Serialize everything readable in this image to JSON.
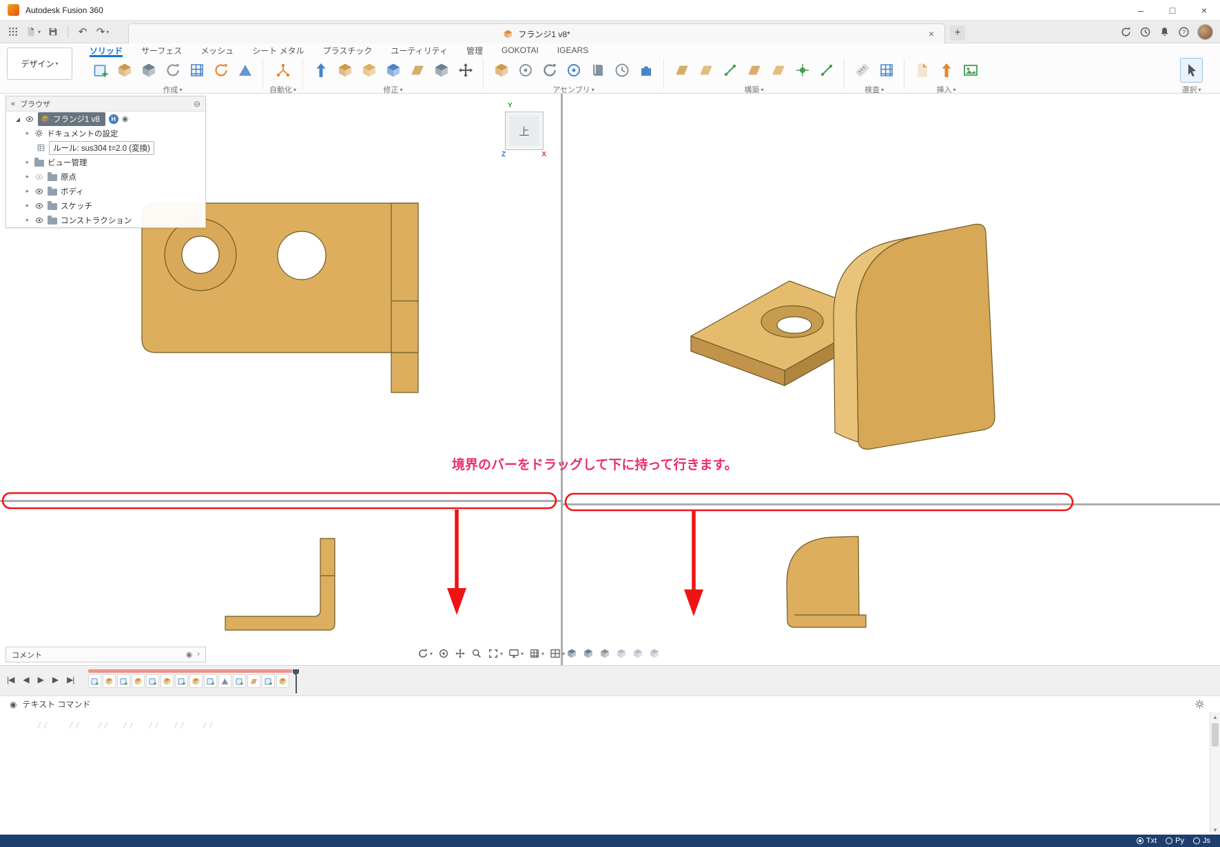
{
  "titlebar": {
    "app_title": "Autodesk Fusion 360",
    "window_controls": {
      "minimize": "–",
      "maximize": "□",
      "close": "×"
    }
  },
  "tabbar": {
    "document_tab": {
      "label": "フランジ1 v8*",
      "close": "×"
    },
    "new_tab": "+",
    "left_icons": [
      "app-grid",
      "file-new",
      "save",
      "undo",
      "redo"
    ],
    "right_icons": [
      "job-status",
      "version-history",
      "notifications",
      "help",
      "avatar"
    ]
  },
  "ribbon": {
    "workspace_button": "デザイン",
    "tabs": [
      {
        "label": "ソリッド",
        "active": true
      },
      {
        "label": "サーフェス",
        "active": false
      },
      {
        "label": "メッシュ",
        "active": false
      },
      {
        "label": "シート メタル",
        "active": false
      },
      {
        "label": "プラスチック",
        "active": false
      },
      {
        "label": "ユーティリティ",
        "active": false
      },
      {
        "label": "管理",
        "active": false
      },
      {
        "label": "GOKOTAI",
        "active": false
      },
      {
        "label": "IGEARS",
        "active": false
      }
    ],
    "groups": [
      {
        "label": "作成",
        "icons": [
          "create-sketch",
          "create-form",
          "extrude",
          "revolve",
          "pattern",
          "coil",
          "loft"
        ]
      },
      {
        "label": "自動化",
        "icons": [
          "automated-modeling"
        ]
      },
      {
        "label": "修正",
        "icons": [
          "press-pull",
          "fillet",
          "shell",
          "combine",
          "replace-face",
          "split-body",
          "move-copy"
        ]
      },
      {
        "label": "アセンブリ",
        "icons": [
          "new-component",
          "joint",
          "as-built-joint",
          "joint-origin",
          "rigid-group",
          "motion-study",
          "contact-sets"
        ]
      },
      {
        "label": "構築",
        "icons": [
          "offset-plane",
          "midplane",
          "axis",
          "plane-at-angle",
          "tangent-plane",
          "point",
          "line"
        ]
      },
      {
        "label": "検査",
        "icons": [
          "measure",
          "section-analysis"
        ]
      },
      {
        "label": "挿入",
        "icons": [
          "insert-derive",
          "insert-dxf",
          "canvas"
        ]
      },
      {
        "label": "選択",
        "icons": [
          "select"
        ]
      }
    ]
  },
  "browser": {
    "title": "ブラウザ",
    "root": {
      "label": "フランジ1 v8",
      "badge": "H"
    },
    "items": [
      {
        "label": "ドキュメントの設定",
        "icon": "gear"
      },
      {
        "label": "ルール: sus304 t=2.0 (変換)",
        "icon": "rule-sheet"
      },
      {
        "label": "ビュー管理",
        "icon": "folder"
      },
      {
        "label": "原点",
        "icon": "folder",
        "visible": false
      },
      {
        "label": "ボディ",
        "icon": "folder",
        "visible": true
      },
      {
        "label": "スケッチ",
        "icon": "folder",
        "visible": true
      },
      {
        "label": "コンストラクション",
        "icon": "folder",
        "visible": true
      }
    ]
  },
  "viewcube": {
    "face": "上",
    "axis_x": "X",
    "axis_y": "Y",
    "axis_z": "Z"
  },
  "annotation": {
    "text": "境界のバーをドラッグして下に持って行きます。",
    "color": "#ea2e66",
    "highlight_color": "#f01616"
  },
  "panels": {
    "comment": "コメント",
    "text_command": "テキスト コマンド",
    "text_command_ghost": "/ /       / /      / /     / /     / /     / /      / /"
  },
  "nav_toolbar": {
    "left": [
      "orbit",
      "look-at",
      "pan",
      "zoom",
      "fit",
      "display-settings",
      "grid-settings",
      "viewport-layout"
    ],
    "right": [
      "shaded-cube",
      "shaded-cube",
      "shaded-cube",
      "wire-cube",
      "wire-cube",
      "wire-cube"
    ]
  },
  "timeline": {
    "playback": [
      "go-to-start",
      "step-back",
      "play",
      "step-forward",
      "go-to-end"
    ],
    "playback_glyphs": [
      "|◀",
      "◀",
      "▶",
      "▶",
      "▶|"
    ],
    "features": [
      "sketch",
      "extrude",
      "sketch",
      "hole",
      "sketch",
      "fillet",
      "sketch",
      "shell",
      "sketch",
      "mirror",
      "sketch",
      "flange",
      "sketch",
      "extrude"
    ]
  },
  "statusbar": {
    "options": [
      {
        "label": "Txt",
        "selected": true
      },
      {
        "label": "Py",
        "selected": false
      },
      {
        "label": "Js",
        "selected": false
      }
    ]
  },
  "model": {
    "part_color": "#dcae5e"
  }
}
